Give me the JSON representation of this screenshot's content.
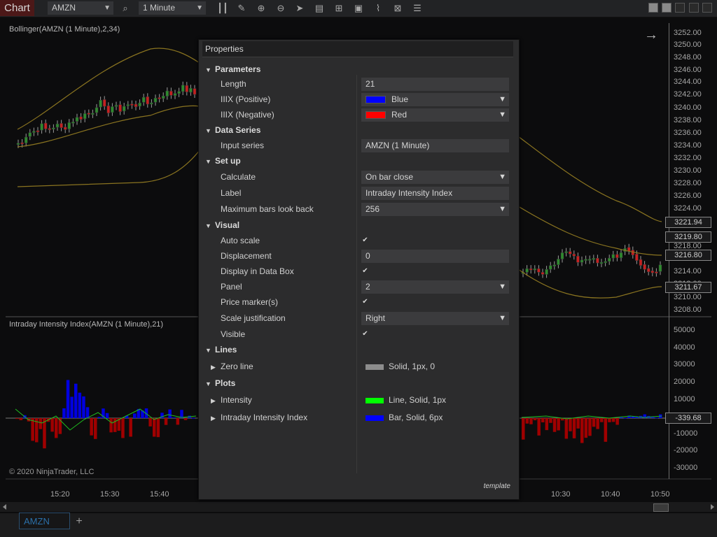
{
  "toolbar": {
    "chart_tab": "Chart",
    "instrument": "AMZN",
    "interval": "1 Minute",
    "icons": [
      "search-icon",
      "bar-chart-icon",
      "draw-pencil-icon",
      "zoom-in-icon",
      "zoom-out-icon",
      "cursor-icon",
      "data-box-icon",
      "properties-icon",
      "templates-icon",
      "strategies-icon",
      "indicators-icon",
      "more-icon"
    ]
  },
  "chart": {
    "top_label": "Bollinger(AMZN (1 Minute),2,34)",
    "bottom_label": "Intraday Intensity Index(AMZN (1 Minute),21)",
    "copyright": "© 2020 NinjaTrader, LLC",
    "price_ticks": [
      "3252.00",
      "3250.00",
      "3248.00",
      "3246.00",
      "3244.00",
      "3242.00",
      "3240.00",
      "3238.00",
      "3236.00",
      "3234.00",
      "3232.00",
      "3230.00",
      "3228.00",
      "3226.00",
      "3224.00",
      "3218.00",
      "3214.00",
      "3212.00",
      "3210.00",
      "3208.00"
    ],
    "price_markers": [
      "3221.94",
      "3219.80",
      "3216.80",
      "3211.67"
    ],
    "indicator_ticks": [
      "50000",
      "40000",
      "30000",
      "20000",
      "10000",
      "-10000",
      "-20000",
      "-30000"
    ],
    "indicator_marker": "-339.68",
    "time_ticks": [
      "15:20",
      "15:30",
      "15:40",
      "10:30",
      "10:40",
      "10:50"
    ],
    "colors": {
      "up": "#2e8b2e",
      "down": "#c82020",
      "band": "#8a7420",
      "bar_pos": "#0000e0",
      "bar_neg": "#a00000",
      "line": "#1fbf1f"
    }
  },
  "dialog": {
    "title": "Properties",
    "parameters": {
      "header": "Parameters",
      "length_label": "Length",
      "length_value": "21",
      "pos_label": "IIIX (Positive)",
      "pos_value": "Blue",
      "pos_color": "#0000ff",
      "neg_label": "IIIX (Negative)",
      "neg_value": "Red",
      "neg_color": "#ff0000"
    },
    "data_series": {
      "header": "Data Series",
      "input_label": "Input series",
      "input_value": "AMZN (1 Minute)"
    },
    "setup": {
      "header": "Set up",
      "calculate_label": "Calculate",
      "calculate_value": "On bar close",
      "label_label": "Label",
      "label_value": "Intraday Intensity Index",
      "maxbars_label": "Maximum bars look back",
      "maxbars_value": "256"
    },
    "visual": {
      "header": "Visual",
      "autoscale_label": "Auto scale",
      "displacement_label": "Displacement",
      "displacement_value": "0",
      "databox_label": "Display in Data Box",
      "panel_label": "Panel",
      "panel_value": "2",
      "pricemarker_label": "Price marker(s)",
      "scale_label": "Scale justification",
      "scale_value": "Right",
      "visible_label": "Visible"
    },
    "lines": {
      "header": "Lines",
      "zero_label": "Zero line",
      "zero_value": "Solid, 1px, 0",
      "zero_color": "#8c8c8c"
    },
    "plots": {
      "header": "Plots",
      "intensity_label": "Intensity",
      "intensity_value": "Line, Solid, 1px",
      "intensity_color": "#00ff00",
      "iii_label": "Intraday Intensity Index",
      "iii_value": "Bar, Solid, 6px",
      "iii_color": "#0000ff"
    },
    "footer": "template"
  },
  "bottom": {
    "tab": "AMZN",
    "add": "+"
  }
}
